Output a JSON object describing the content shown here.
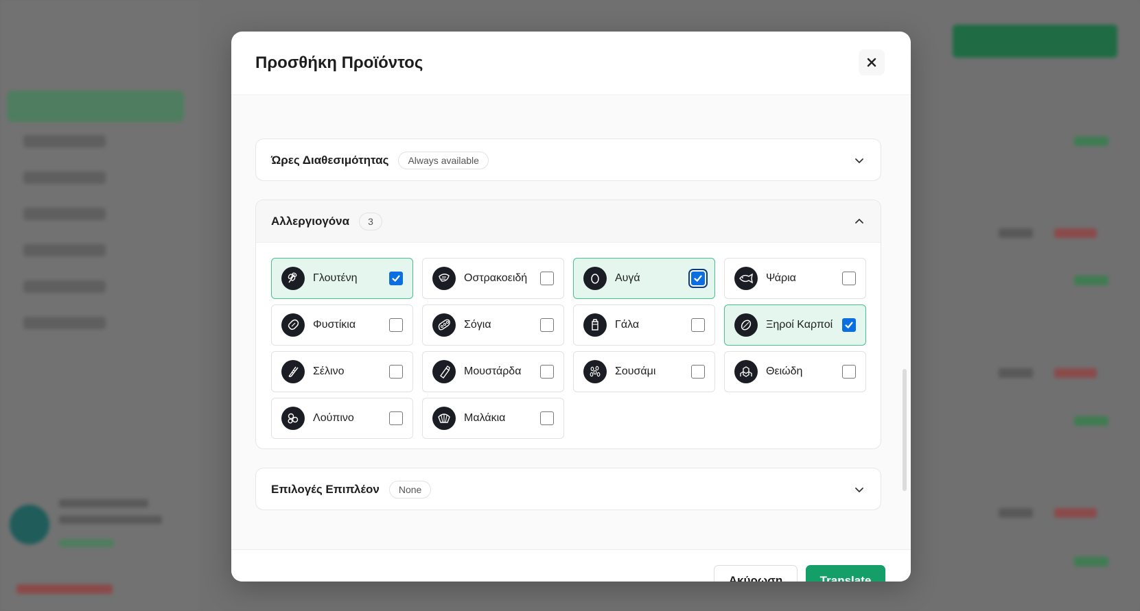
{
  "modal": {
    "title": "Προσθήκη Προϊόντος",
    "close_icon": "close-icon"
  },
  "availability": {
    "title": "Ώρες Διαθεσιμότητας",
    "badge": "Always available",
    "expanded": false
  },
  "allergens": {
    "title": "Αλλεργιογόνα",
    "count": "3",
    "expanded": true,
    "items": [
      {
        "label": "Γλουτένη",
        "icon": "wheat-icon",
        "checked": true
      },
      {
        "label": "Οστρακοειδή",
        "icon": "shrimp-icon",
        "checked": false
      },
      {
        "label": "Αυγά",
        "icon": "egg-icon",
        "checked": true
      },
      {
        "label": "Ψάρια",
        "icon": "fish-icon",
        "checked": false
      },
      {
        "label": "Φυστίκια",
        "icon": "peanut-icon",
        "checked": false
      },
      {
        "label": "Σόγια",
        "icon": "soy-icon",
        "checked": false
      },
      {
        "label": "Γάλα",
        "icon": "milk-icon",
        "checked": false
      },
      {
        "label": "Ξηροί Καρποί",
        "icon": "nut-icon",
        "checked": true
      },
      {
        "label": "Σέλινο",
        "icon": "celery-icon",
        "checked": false
      },
      {
        "label": "Μουστάρδα",
        "icon": "mustard-icon",
        "checked": false
      },
      {
        "label": "Σουσάμι",
        "icon": "sesame-icon",
        "checked": false
      },
      {
        "label": "Θειώδη",
        "icon": "sulphite-icon",
        "checked": false
      },
      {
        "label": "Λούπινο",
        "icon": "lupin-icon",
        "checked": false
      },
      {
        "label": "Μαλάκια",
        "icon": "mollusc-icon",
        "checked": false
      }
    ]
  },
  "extras": {
    "title": "Επιλογές Επιπλέον",
    "badge": "None",
    "expanded": false
  },
  "footer": {
    "cancel_label": "Ακύρωση",
    "primary_label": "Translate"
  },
  "colors": {
    "primary": "#159f68",
    "checked_bg": "#e4f6ee",
    "checked_border": "#46c28b",
    "checkbox_on": "#0b6fe0"
  }
}
